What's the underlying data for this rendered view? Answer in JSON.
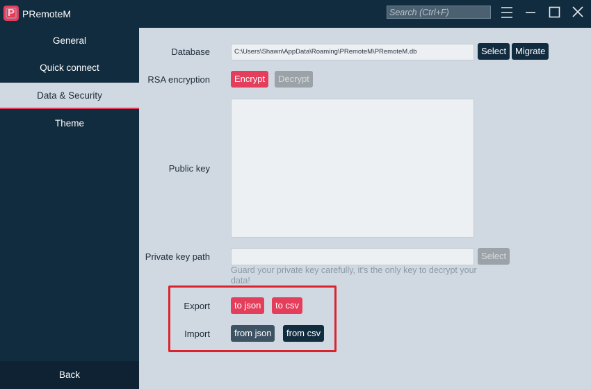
{
  "titlebar": {
    "app_title": "PRemoteM",
    "logo_letter": "P",
    "search_placeholder": "Search (Ctrl+F)",
    "menu_icon": "hamburger-icon",
    "minimize_icon": "minimize-icon",
    "maximize_icon": "maximize-icon",
    "close_icon": "close-icon"
  },
  "sidebar": {
    "items": [
      {
        "label": "General"
      },
      {
        "label": "Quick connect"
      },
      {
        "label": "Data & Security"
      },
      {
        "label": "Theme"
      }
    ],
    "active_index": 2,
    "back_label": "Back"
  },
  "settings": {
    "database": {
      "label": "Database",
      "path": "C:\\Users\\Shawn\\AppData\\Roaming\\PRemoteM\\PRemoteM.db",
      "select_label": "Select",
      "migrate_label": "Migrate"
    },
    "rsa": {
      "label": "RSA encryption",
      "encrypt_label": "Encrypt",
      "decrypt_label": "Decrypt"
    },
    "public_key": {
      "label": "Public key",
      "value": ""
    },
    "private_key": {
      "label": "Private key path",
      "value": "",
      "select_label": "Select",
      "hint": "Guard your private key carefully, it's the only key to decrypt your data!"
    },
    "export": {
      "label": "Export",
      "json_label": "to json",
      "csv_label": "to csv"
    },
    "import": {
      "label": "Import",
      "json_label": "from json",
      "csv_label": "from csv"
    }
  },
  "colors": {
    "titlebar_bg": "#122c3f",
    "content_bg": "#d0d9e2",
    "accent": "#e53e5c",
    "highlight": "#d9242e"
  }
}
